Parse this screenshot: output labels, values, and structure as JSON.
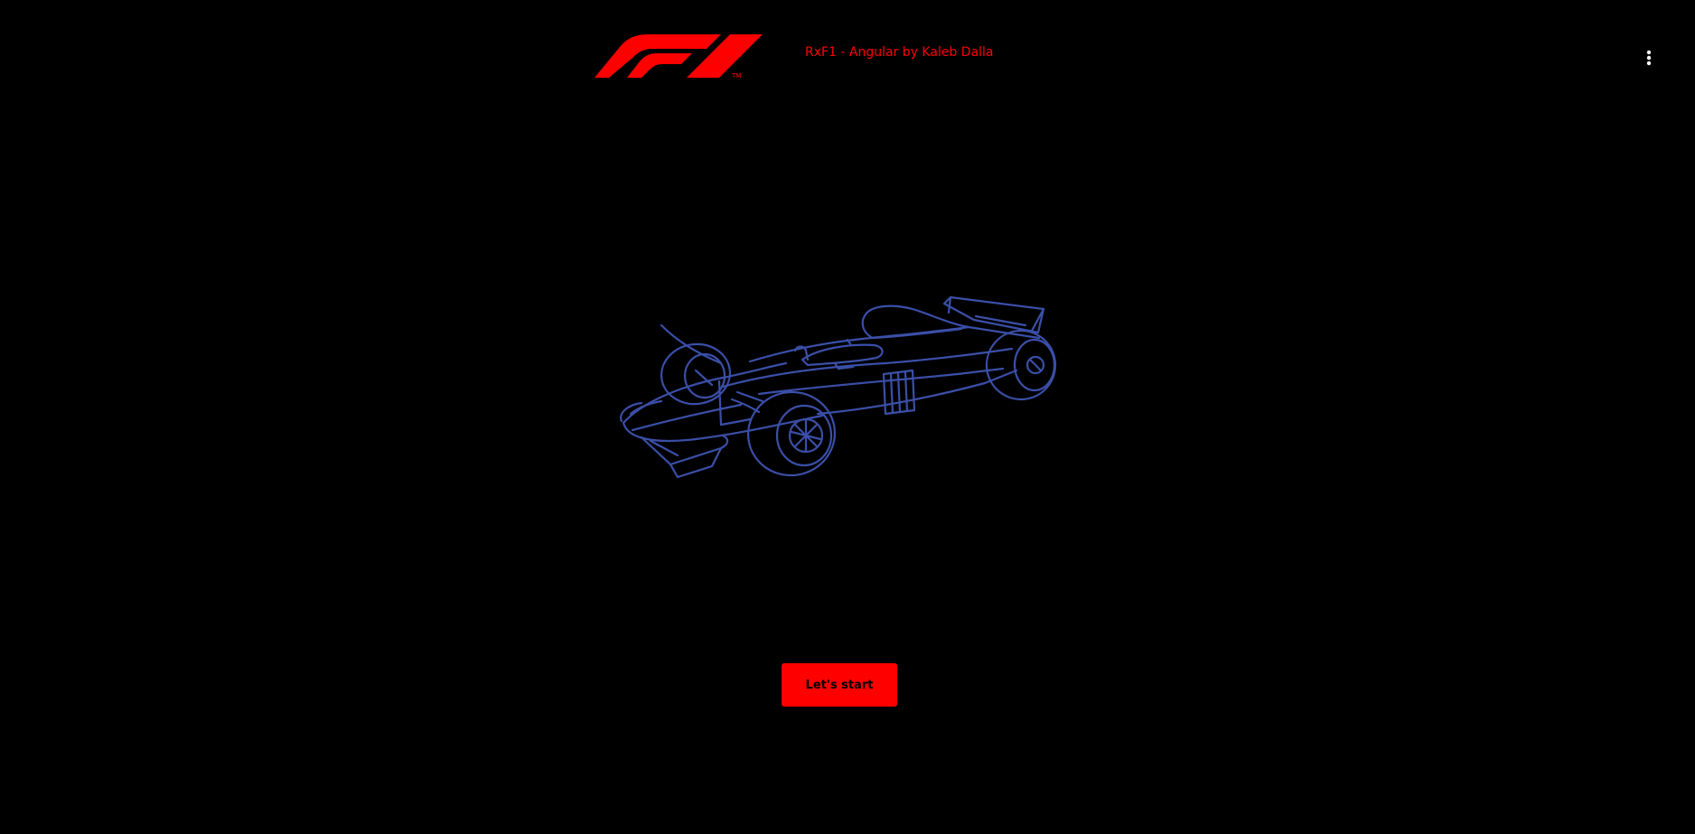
{
  "theme": {
    "background": "#000000",
    "accent": "#ff0000",
    "outline": "#3b4fa8",
    "button_text": "#000000",
    "menu_icon": "#ffffff"
  },
  "header": {
    "logo_icon": "f1-logo-icon",
    "title": "RxF1 - Angular by Kaleb Dalla",
    "menu_icon": "more-vert-icon"
  },
  "hero": {
    "illustration_icon": "f1-car-outline-icon"
  },
  "actions": {
    "start_label": "Let's start"
  }
}
